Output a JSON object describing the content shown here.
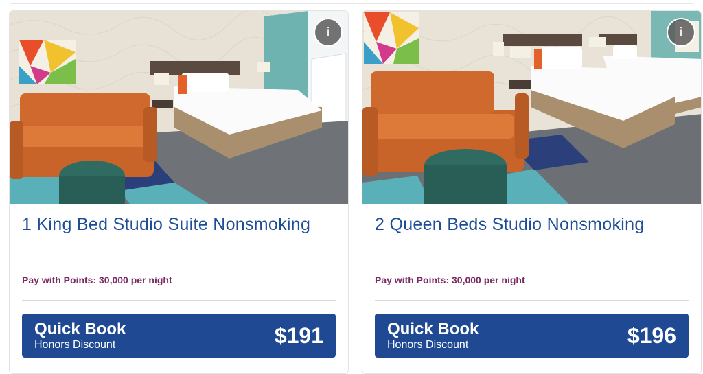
{
  "rooms": [
    {
      "title": "1 King Bed Studio Suite Nonsmoking",
      "points": "Pay with Points: 30,000 per night",
      "quick_book": {
        "title": "Quick Book",
        "subtitle": "Honors Discount",
        "price": "$191"
      },
      "info_label": "i"
    },
    {
      "title": "2 Queen Beds Studio Nonsmoking",
      "points": "Pay with Points: 30,000 per night",
      "quick_book": {
        "title": "Quick Book",
        "subtitle": "Honors Discount",
        "price": "$196"
      },
      "info_label": "i"
    }
  ],
  "colors": {
    "title_blue": "#1f4e96",
    "points_plum": "#7a2961",
    "button_blue": "#1f4a93"
  }
}
